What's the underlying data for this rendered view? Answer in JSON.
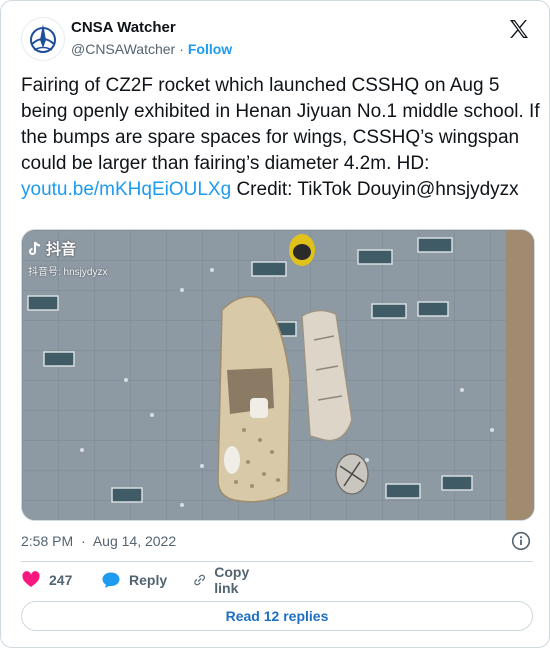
{
  "author": {
    "display_name": "CNSA Watcher",
    "handle": "@CNSAWatcher",
    "separator": "·",
    "follow_label": "Follow"
  },
  "tweet": {
    "text_before_link": "Fairing of CZ2F rocket which launched CSSHQ on Aug 5 being openly exhibited in Henan Jiyuan No.1 middle school. If the bumps are spare spaces for wings, CSSHQ’s wingspan could be larger than fairing’s diameter 4.2m. HD: ",
    "link_text": "youtu.be/mKHqEiOULXg",
    "text_after_link": " Credit: TikTok Douyin@hnsjydyzx"
  },
  "media": {
    "watermark_brand": "抖音",
    "watermark_id": "抖音号: hnsjydyzx"
  },
  "meta": {
    "time": "2:58 PM",
    "separator": "·",
    "date": "Aug 14, 2022"
  },
  "actions": {
    "like_count": "247",
    "reply_label": "Reply",
    "copy_link_label": "Copy link"
  },
  "replies_button_label": "Read 12 replies",
  "colors": {
    "accent_blue": "#1d9bf0",
    "like_red": "#f91880",
    "secondary_text": "#536471",
    "border": "#cfd9de"
  },
  "icons": [
    "cnsa-logo-avatar",
    "x-logo-icon",
    "douyin-logo-icon",
    "info-icon",
    "heart-icon",
    "reply-bubble-icon",
    "link-icon"
  ]
}
